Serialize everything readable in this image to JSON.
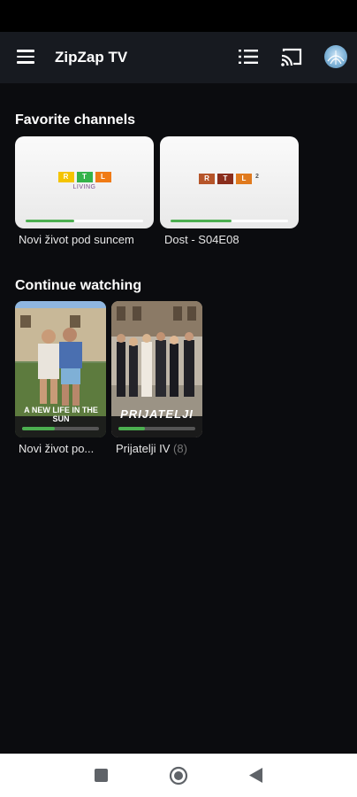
{
  "app": {
    "title": "ZipZap TV"
  },
  "header": {
    "menu_icon": "hamburger-icon",
    "list_icon": "list-icon",
    "cast_icon": "cast-icon",
    "avatar_icon": "avatar-icon"
  },
  "favorites": {
    "title": "Favorite channels",
    "items": [
      {
        "caption": "Novi život pod suncem",
        "logo_letters": [
          "R",
          "T",
          "L"
        ],
        "logo_sub": "LIVING",
        "progress": 0.41,
        "logo_colors": [
          "#f4c400",
          "#34b34a",
          "#f07b15"
        ]
      },
      {
        "caption": "Dost - S04E08",
        "logo_letters": [
          "R",
          "T",
          "L"
        ],
        "logo_sub": "2",
        "progress": 0.52,
        "logo_colors": [
          "#b6552a",
          "#8a2d1c",
          "#e07a1e"
        ]
      }
    ]
  },
  "continue": {
    "title": "Continue watching",
    "items": [
      {
        "caption_main": "Novi život po...",
        "caption_extra": "",
        "poster_text": "A NEW LIFE IN THE SUN",
        "progress": 0.42
      },
      {
        "caption_main": "Prijatelji IV",
        "caption_extra": " (8)",
        "poster_text": "PRIJATELJI",
        "progress": 0.34
      }
    ]
  },
  "colors": {
    "accent": "#4caf50",
    "background": "#0b0c0f",
    "app_bar": "#171a20"
  },
  "navbar": {
    "square_icon": "recents-square-icon",
    "home_icon": "home-circle-icon",
    "back_icon": "back-triangle-icon"
  }
}
